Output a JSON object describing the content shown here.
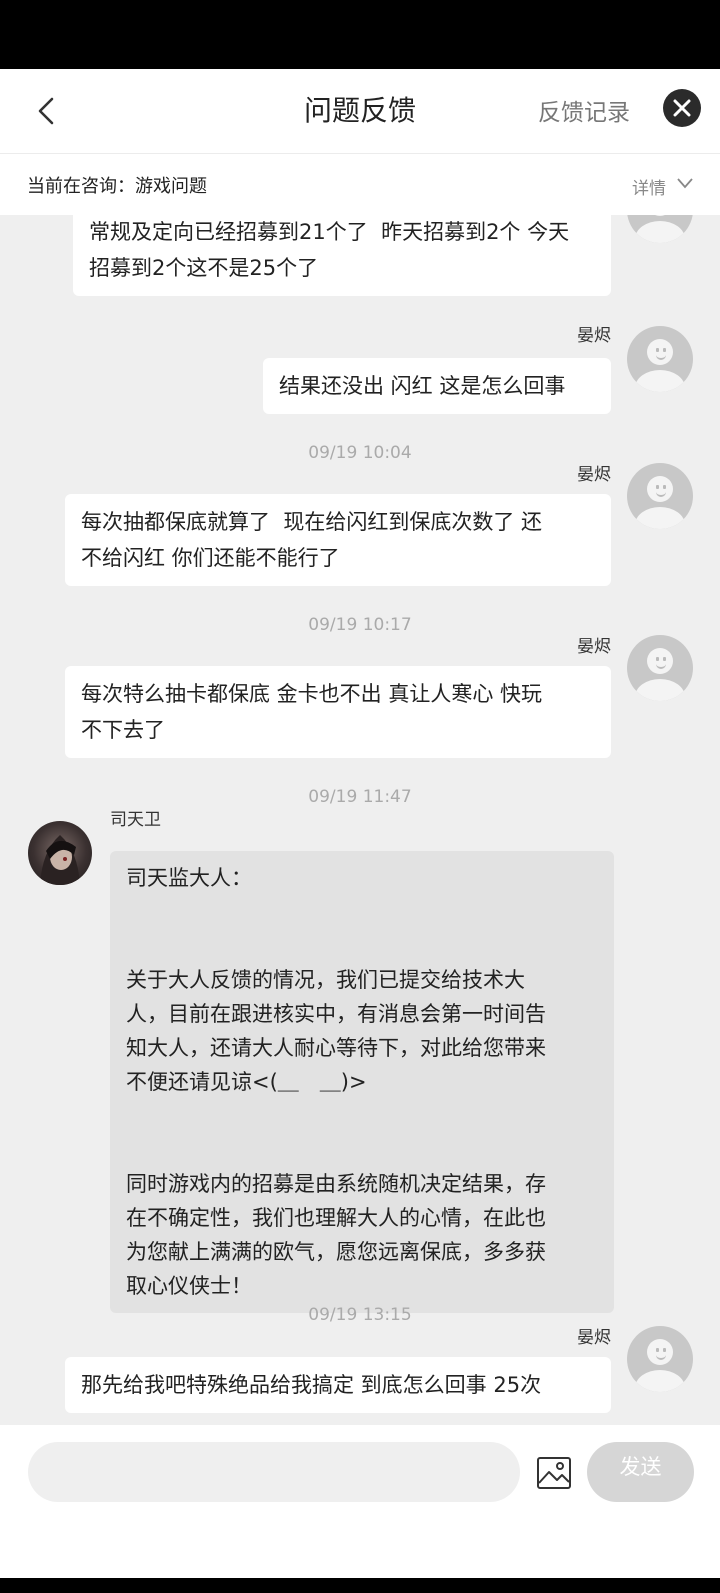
{
  "header": {
    "title": "问题反馈",
    "record_label": "反馈记录"
  },
  "consult": {
    "text": "当前在咨询：游戏问题",
    "detail_label": "详情"
  },
  "messages": {
    "m0": {
      "text": "常规及定向已经招募到21个了  昨天招募到2个 今天\n招募到2个这不是25个了"
    },
    "m1": {
      "name": "晏烬",
      "text": "结果还没出 闪红 这是怎么回事"
    },
    "m2": {
      "time": "09/19 10:04",
      "name": "晏烬",
      "text": "每次抽都保底就算了  现在给闪红到保底次数了 还\n不给闪红 你们还能不能行了"
    },
    "m3": {
      "time": "09/19 10:17",
      "name": "晏烬",
      "text": "每次特么抽卡都保底 金卡也不出 真让人寒心 快玩\n不下去了"
    },
    "m4": {
      "time": "09/19 11:47",
      "name": "司天卫",
      "text": "司天监大人：\n\n\n关于大人反馈的情况，我们已提交给技术大\n人，目前在跟进核实中，有消息会第一时间告\n知大人，还请大人耐心等待下，对此给您带来\n不便还请见谅<(＿　＿)>\n\n\n同时游戏内的招募是由系统随机决定结果，存\n在不确定性，我们也理解大人的心情，在此也\n为您献上满满的欧气，愿您远离保底，多多获\n取心仪侠士！"
    },
    "m5": {
      "time": "09/19 13:15",
      "name": "晏烬",
      "text": "那先给我吧特殊绝品给我搞定 到底怎么回事 25次"
    }
  },
  "composer": {
    "input_value": "",
    "input_placeholder": "",
    "send_label": "发送"
  }
}
